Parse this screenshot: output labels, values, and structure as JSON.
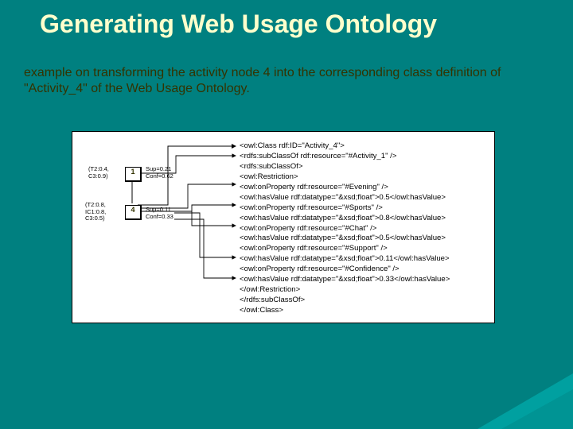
{
  "title": "Generating Web Usage Ontology",
  "subtitle": "example on transforming the activity node 4 into the corresponding class definition of \"Activity_4\" of the Web Usage Ontology.",
  "diagram": {
    "node1": {
      "id": "1",
      "labelLeft": "(T2:0.4,\nC3:0.9)",
      "labelRight": "Sup=0.21\nConf=0.62"
    },
    "node4": {
      "id": "4",
      "labelLeft": "(T2:0.8,\nIC1:0.8,\nC3:0.5)",
      "labelRight": "Sup=0.11\nConf=0.33"
    }
  },
  "owl": {
    "l0": "<owl:Class rdf:ID=\"Activity_4\">",
    "l1": "<rdfs:subClassOf rdf:resource=\"#Activity_1\" />",
    "l2": "<rdfs:subClassOf>",
    "l3": "<owl:Restriction>",
    "l4": "<owl:onProperty rdf:resource=\"#Evening\" />",
    "l5": "<owl:hasValue rdf:datatype=\"&xsd;float\">0.5</owl:hasValue>",
    "l6": "<owl:onProperty rdf:resource=\"#Sports\" />",
    "l7": "<owl:hasValue rdf:datatype=\"&xsd;float\">0.8</owl:hasValue>",
    "l8": "<owl:onProperty rdf:resource=\"#Chat\" />",
    "l9": "<owl:hasValue rdf:datatype=\"&xsd;float\">0.5</owl:hasValue>",
    "l10": "<owl:onProperty rdf:resource=\"#Support\" />",
    "l11": "<owl:hasValue rdf:datatype=\"&xsd;float\">0.11</owl:hasValue>",
    "l12": "<owl:onProperty rdf:resource=\"#Confidence\" />",
    "l13": "<owl:hasValue rdf:datatype=\"&xsd;float\">0.33</owl:hasValue>",
    "l14": "</owl:Restriction>",
    "l15": "</rdfs:subClassOf>",
    "l16": "</owl:Class>"
  }
}
